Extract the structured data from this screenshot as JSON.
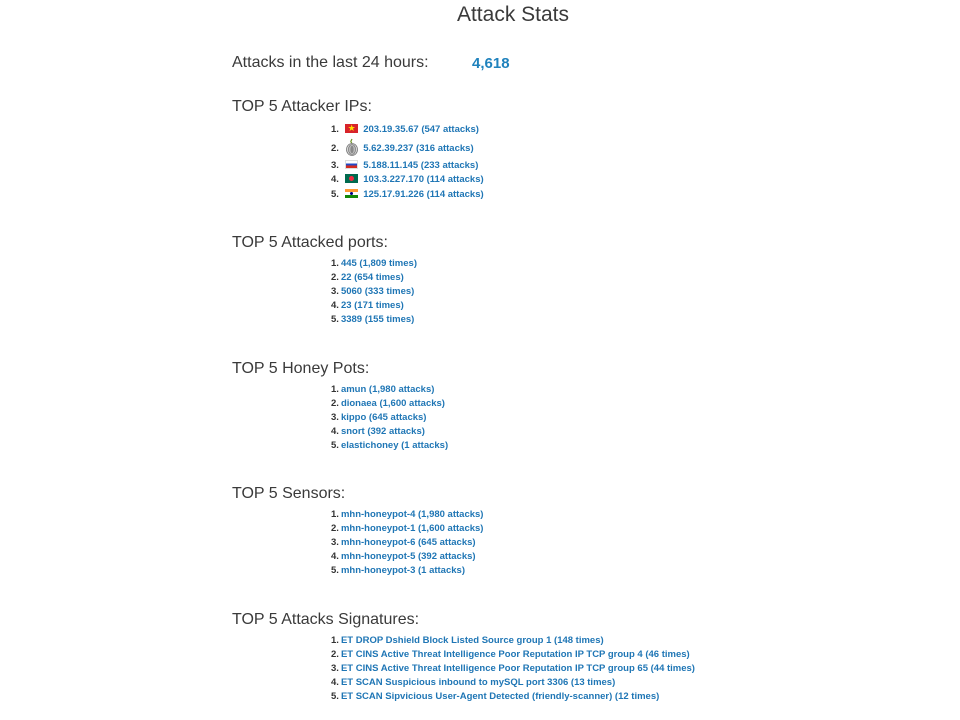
{
  "page": {
    "title": "Attack Stats"
  },
  "summary": {
    "label": "Attacks in the last 24 hours:",
    "value": "4,618"
  },
  "attacker_ips": {
    "heading": "TOP 5 Attacker IPs:",
    "items": [
      {
        "num": "1.",
        "flag": "vietnam-flag-icon",
        "text": "203.19.35.67 (547 attacks)"
      },
      {
        "num": "2.",
        "flag": "tor-onion-icon",
        "text": "5.62.39.237 (316 attacks)"
      },
      {
        "num": "3.",
        "flag": "russia-flag-icon",
        "text": "5.188.11.145 (233 attacks)"
      },
      {
        "num": "4.",
        "flag": "bangladesh-flag-icon",
        "text": "103.3.227.170 (114 attacks)"
      },
      {
        "num": "5.",
        "flag": "india-flag-icon",
        "text": "125.17.91.226 (114 attacks)"
      }
    ]
  },
  "attacked_ports": {
    "heading": "TOP 5 Attacked ports:",
    "items": [
      {
        "num": "1.",
        "text": "445 (1,809 times)"
      },
      {
        "num": "2.",
        "text": "22 (654 times)"
      },
      {
        "num": "3.",
        "text": "5060 (333 times)"
      },
      {
        "num": "4.",
        "text": "23 (171 times)"
      },
      {
        "num": "5.",
        "text": "3389 (155 times)"
      }
    ]
  },
  "honey_pots": {
    "heading": "TOP 5 Honey Pots:",
    "items": [
      {
        "num": "1.",
        "text": "amun (1,980 attacks)"
      },
      {
        "num": "2.",
        "text": "dionaea (1,600 attacks)"
      },
      {
        "num": "3.",
        "text": "kippo (645 attacks)"
      },
      {
        "num": "4.",
        "text": "snort (392 attacks)"
      },
      {
        "num": "5.",
        "text": "elastichoney (1 attacks)"
      }
    ]
  },
  "sensors": {
    "heading": "TOP 5 Sensors:",
    "items": [
      {
        "num": "1.",
        "text": "mhn-honeypot-4 (1,980 attacks)"
      },
      {
        "num": "2.",
        "text": "mhn-honeypot-1 (1,600 attacks)"
      },
      {
        "num": "3.",
        "text": "mhn-honeypot-6 (645 attacks)"
      },
      {
        "num": "4.",
        "text": "mhn-honeypot-5 (392 attacks)"
      },
      {
        "num": "5.",
        "text": "mhn-honeypot-3 (1 attacks)"
      }
    ]
  },
  "signatures": {
    "heading": "TOP 5 Attacks Signatures:",
    "items": [
      {
        "num": "1.",
        "text": "ET DROP Dshield Block Listed Source group 1 (148 times)"
      },
      {
        "num": "2.",
        "text": "ET CINS Active Threat Intelligence Poor Reputation IP TCP group 4 (46 times)"
      },
      {
        "num": "3.",
        "text": "ET CINS Active Threat Intelligence Poor Reputation IP TCP group 65 (44 times)"
      },
      {
        "num": "4.",
        "text": "ET SCAN Suspicious inbound to mySQL port 3306 (13 times)"
      },
      {
        "num": "5.",
        "text": "ET SCAN Sipvicious User-Agent Detected (friendly-scanner) (12 times)"
      }
    ]
  }
}
